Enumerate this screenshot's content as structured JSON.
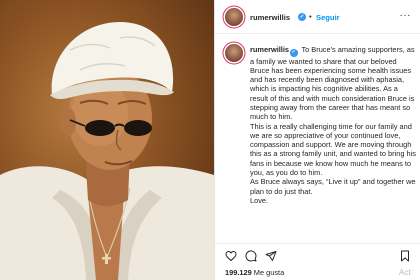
{
  "post": {
    "username": "rumerwillis",
    "follow_label": "Seguir",
    "verified_glyph": "✓",
    "dot": "•",
    "more_glyph": "···",
    "caption_user": "rumerwillis",
    "caption_paragraphs": [
      "To Bruce's amazing supporters, as a family we wanted to share that our beloved Bruce has been experiencing some health issues and has recently been diagnosed with aphasia, which is impacting his cognitive abilities. As a result of this and with much consideration Bruce is stepping away from the career that has meant so much to him.",
      "This is a really challenging time for our family and we are so appreciative of your continued love, compassion and support. We are moving through this as a strong family unit, and wanted to bring his fans in because we know how much he means to you, as you do to him.",
      "As Bruce always says, “Live it up” and together we plan to do just that.",
      "Love."
    ],
    "likes_count": "199.129",
    "likes_label": "Me gusta",
    "watermark": "Act"
  },
  "icons": [
    "heart-icon",
    "comment-icon",
    "share-icon",
    "bookmark-icon",
    "verified-badge-icon",
    "more-options-icon"
  ],
  "colors": {
    "verified": "#3897f0",
    "follow": "#0095f6",
    "story_ring": "#e1306c",
    "text": "#262626"
  }
}
